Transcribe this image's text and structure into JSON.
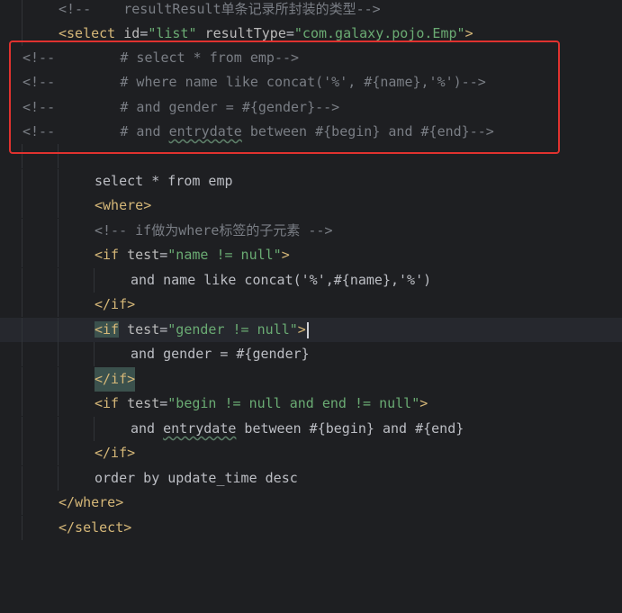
{
  "editor": {
    "lines": {
      "l1": {
        "open": "<!--",
        "text": "    resultResult单条记录所封装的类型",
        "close": "-->"
      },
      "l2": {
        "lt": "<",
        "tag": "select",
        "sp1": " ",
        "attr1": "id",
        "eq1": "=",
        "val1": "\"list\"",
        "sp2": " ",
        "attr2": "resultType",
        "eq2": "=",
        "val2": "\"com.galaxy.pojo.Emp\"",
        "gt": ">"
      },
      "l3": {
        "open": "<!--",
        "text": "        # select * from emp",
        "close": "-->"
      },
      "l4": {
        "open": "<!--",
        "text": "        # where name like concat('%', #{name},'%')",
        "close": "-->"
      },
      "l5": {
        "open": "<!--",
        "text": "        # and gender = #{gender}",
        "close": "-->"
      },
      "l6": {
        "open": "<!--",
        "pre": "        # and ",
        "under": "entrydate",
        "post": " between #{begin} and #{end}",
        "close": "-->"
      },
      "l8": {
        "text": "select * from emp"
      },
      "l9": {
        "lt": "<",
        "tag": "where",
        "gt": ">"
      },
      "l10": {
        "text": "<!-- if做为where标签的子元素 -->"
      },
      "l11": {
        "lt": "<",
        "tag": "if",
        "sp": " ",
        "attr": "test",
        "eq": "=",
        "val": "\"name != null\"",
        "gt": ">"
      },
      "l12": {
        "text": "and name like concat('%',#{name},'%')"
      },
      "l13": {
        "tag": "</if>"
      },
      "l14": {
        "lt": "<",
        "tag": "if",
        "sp": " ",
        "attr": "test",
        "eq": "=",
        "val": "\"gender != null\"",
        "gt": ">"
      },
      "l15": {
        "text": "and gender = #{gender}"
      },
      "l16": {
        "tag": "</if>"
      },
      "l17": {
        "lt": "<",
        "tag": "if",
        "sp": " ",
        "attr": "test",
        "eq": "=",
        "val": "\"begin != null and end != null\"",
        "gt": ">"
      },
      "l18": {
        "pre": "and ",
        "under": "entrydate",
        "post": " between #{begin} and #{end}"
      },
      "l19": {
        "tag": "</if>"
      },
      "l20": {
        "text": "order by update_time desc"
      },
      "l21": {
        "tag": "</where>"
      },
      "l22": {
        "tag": "</select>"
      }
    }
  },
  "colors": {
    "background": "#1e1f22",
    "comment": "#7a7e85",
    "tag": "#d5b778",
    "string": "#6aab73",
    "text": "#bcbec4",
    "highlight_box": "#e0322f"
  }
}
